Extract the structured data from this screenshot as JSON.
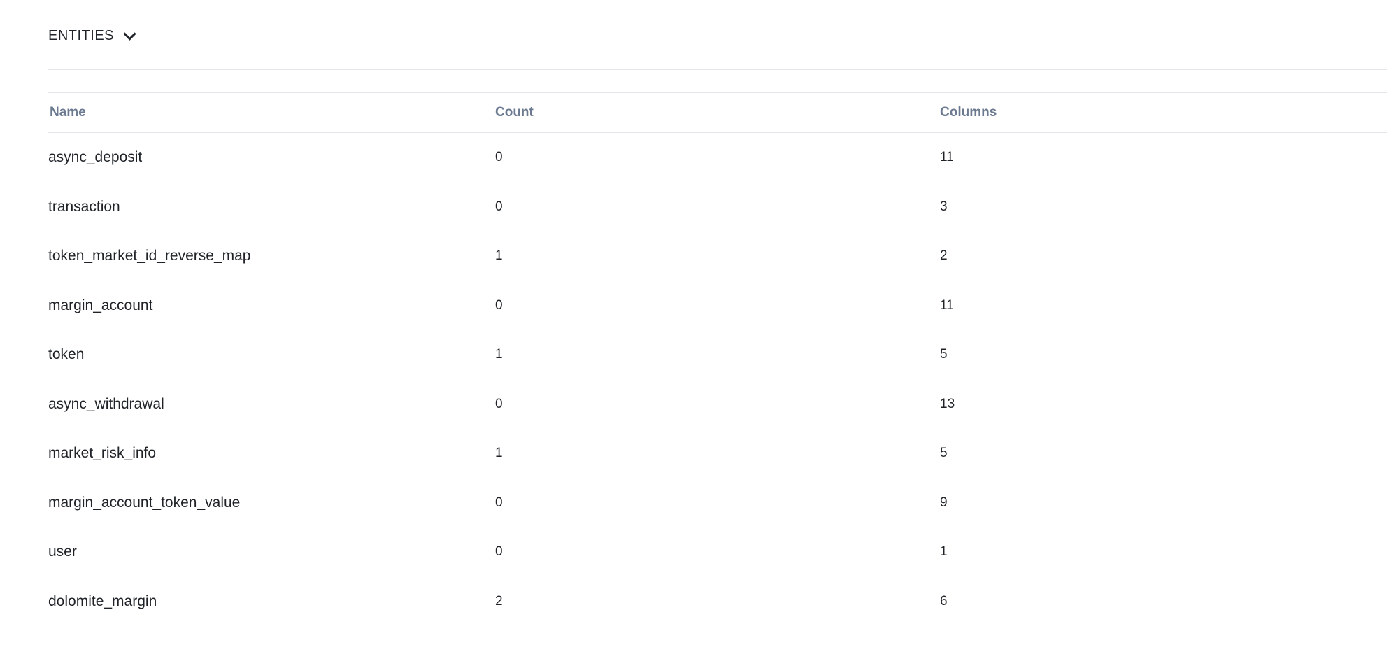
{
  "section": {
    "title": "ENTITIES",
    "toggle_icon": "chevron-down-icon"
  },
  "table": {
    "headers": {
      "name": "Name",
      "count": "Count",
      "columns": "Columns"
    },
    "rows": [
      {
        "name": "async_deposit",
        "count": "0",
        "columns": "11"
      },
      {
        "name": "transaction",
        "count": "0",
        "columns": "3"
      },
      {
        "name": "token_market_id_reverse_map",
        "count": "1",
        "columns": "2"
      },
      {
        "name": "margin_account",
        "count": "0",
        "columns": "11"
      },
      {
        "name": "token",
        "count": "1",
        "columns": "5"
      },
      {
        "name": "async_withdrawal",
        "count": "0",
        "columns": "13"
      },
      {
        "name": "market_risk_info",
        "count": "1",
        "columns": "5"
      },
      {
        "name": "margin_account_token_value",
        "count": "0",
        "columns": "9"
      },
      {
        "name": "user",
        "count": "0",
        "columns": "1"
      },
      {
        "name": "dolomite_margin",
        "count": "2",
        "columns": "6"
      }
    ]
  },
  "colors": {
    "header_text": "#6b7a90",
    "divider": "#e3e6ea",
    "body_text": "#1f2328"
  }
}
